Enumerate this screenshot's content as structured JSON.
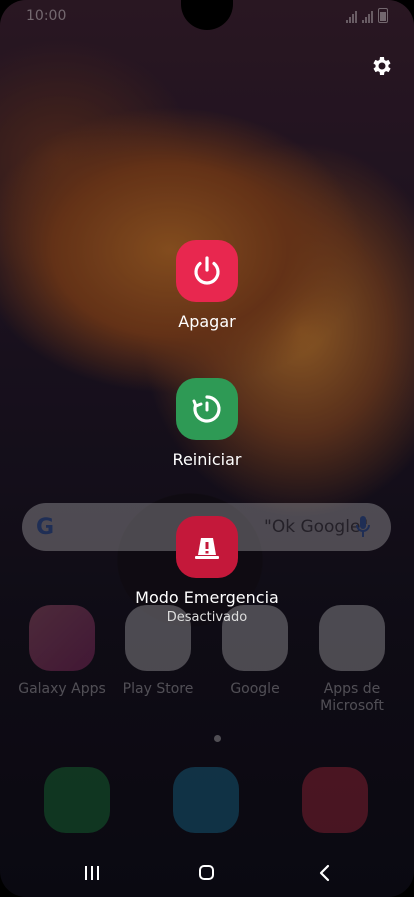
{
  "status_bar": {
    "time": "10:00"
  },
  "search_bar": {
    "hint": "\"Ok Google\""
  },
  "apps": [
    {
      "label": "Galaxy Apps",
      "icon": "galaxy-apps-icon",
      "color": "#e8507a"
    },
    {
      "label": "Play Store",
      "icon": "play-store-icon",
      "color": "#ececec"
    },
    {
      "label": "Google",
      "icon": "google-folder-icon",
      "color": "#ececec"
    },
    {
      "label": "Apps de Microsoft",
      "icon": "microsoft-folder-icon",
      "color": "#ececec"
    }
  ],
  "dock": [
    {
      "icon": "phone-icon",
      "color": "#1faa4a"
    },
    {
      "icon": "messages-icon",
      "color": "#1f9ac8"
    },
    {
      "icon": "camera-icon",
      "color": "#e8344e"
    }
  ],
  "power_menu": {
    "power_off": {
      "label": "Apagar",
      "color": "#e8274f"
    },
    "restart": {
      "label": "Reiniciar",
      "color": "#2e9a55"
    },
    "emergency": {
      "label": "Modo Emergencia",
      "status": "Desactivado",
      "color": "#c4183a"
    }
  }
}
